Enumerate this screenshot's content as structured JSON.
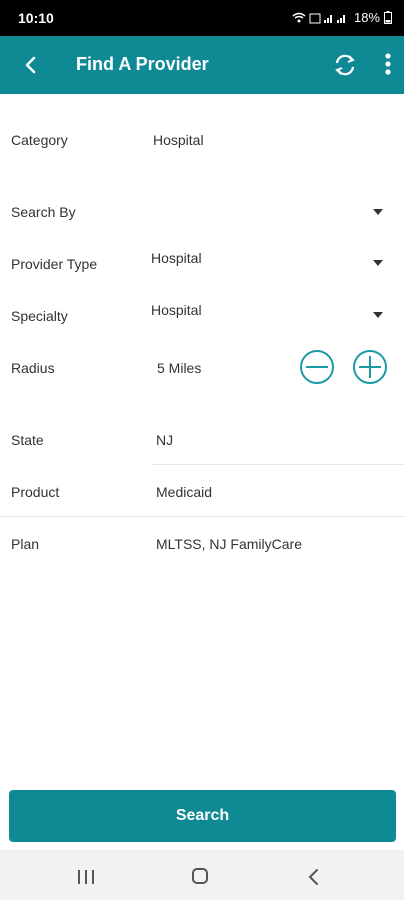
{
  "status": {
    "time": "10:10",
    "battery": "18%",
    "signal_icons": "wifi-signal-icons"
  },
  "app_bar": {
    "title": "Find A Provider"
  },
  "form": {
    "category": {
      "label": "Category",
      "value": "Hospital"
    },
    "search_by": {
      "label": "Search By",
      "value": ""
    },
    "provider_type": {
      "label": "Provider Type",
      "value": "Hospital"
    },
    "specialty": {
      "label": "Specialty",
      "value": "Hospital"
    },
    "radius": {
      "label": "Radius",
      "value": "5 Miles"
    },
    "state": {
      "label": "State",
      "value": "NJ"
    },
    "product": {
      "label": "Product",
      "value": "Medicaid"
    },
    "plan": {
      "label": "Plan",
      "value": "MLTSS, NJ FamilyCare"
    }
  },
  "search_button": {
    "label": "Search"
  },
  "colors": {
    "accent": "#0f8a95",
    "accent_light": "#1a9aa6"
  }
}
